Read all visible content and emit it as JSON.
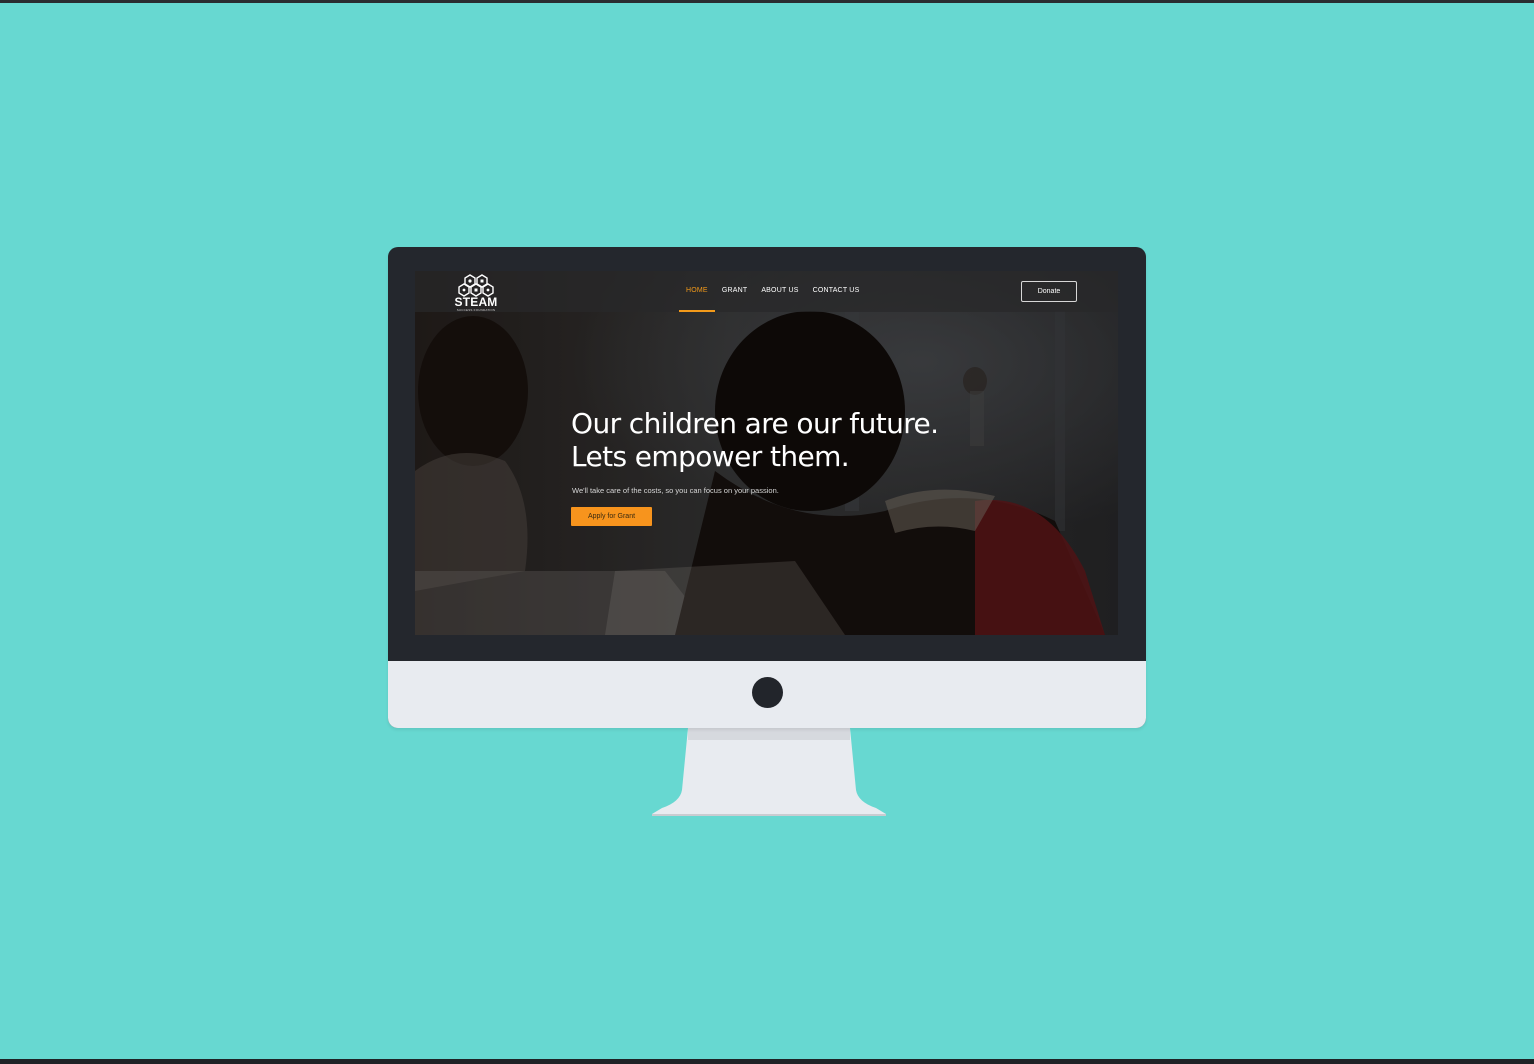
{
  "brand": {
    "name": "STEAM",
    "tagline": "SUCCESS FOUNDATION"
  },
  "nav": {
    "items": [
      {
        "label": "HOME",
        "active": true
      },
      {
        "label": "GRANT",
        "active": false
      },
      {
        "label": "ABOUT US",
        "active": false
      },
      {
        "label": "CONTACT US",
        "active": false
      }
    ],
    "donate_label": "Donate"
  },
  "hero": {
    "title_line1": "Our children are our future.",
    "title_line2": "Lets empower them.",
    "subtitle": "We'll take care of the costs, so you can focus on your passion.",
    "cta_label": "Apply for Grant"
  },
  "colors": {
    "background": "#67d8d1",
    "accent": "#f7941d",
    "monitor_bezel": "#24272d",
    "monitor_chin": "#e8ebf0"
  }
}
